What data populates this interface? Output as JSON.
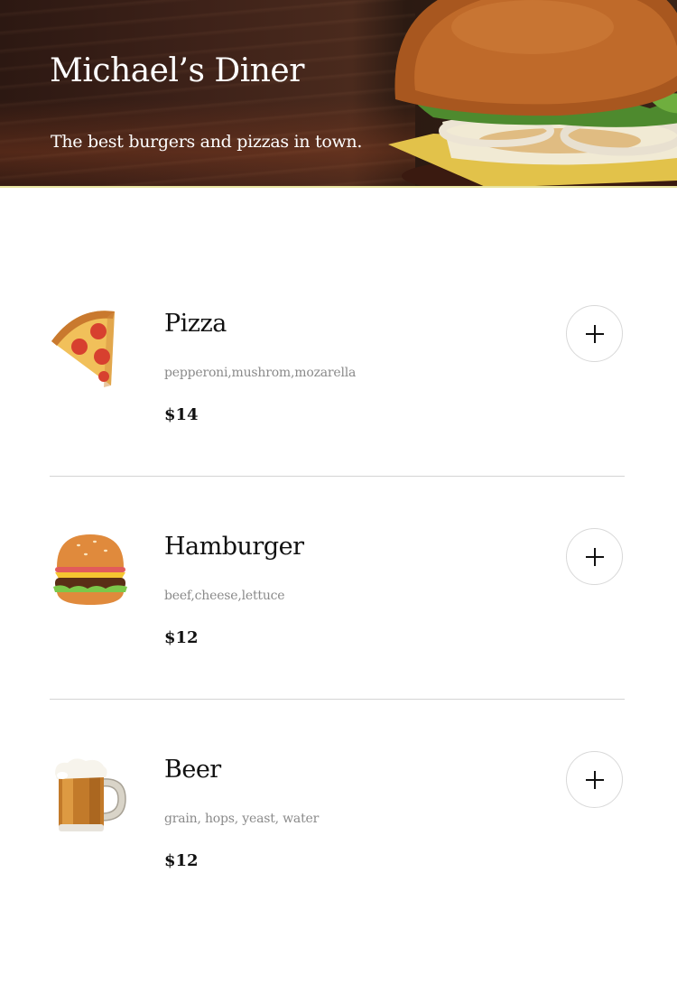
{
  "header": {
    "title": "Michael’s Diner",
    "subtitle": "The best burgers and pizzas in town."
  },
  "menu": {
    "items": [
      {
        "icon": "pizza-icon",
        "name": "Pizza",
        "ingredients": "pepperoni,mushrom,mozarella",
        "price": "$14"
      },
      {
        "icon": "hamburger-icon",
        "name": "Hamburger",
        "ingredients": "beef,cheese,lettuce",
        "price": "$12"
      },
      {
        "icon": "beer-icon",
        "name": "Beer",
        "ingredients": "grain, hops, yeast, water",
        "price": "$12"
      }
    ]
  },
  "colors": {
    "text": "#111111",
    "muted": "#8a8a8a",
    "divider": "#d4d4d4",
    "header_text": "#ffffff"
  }
}
